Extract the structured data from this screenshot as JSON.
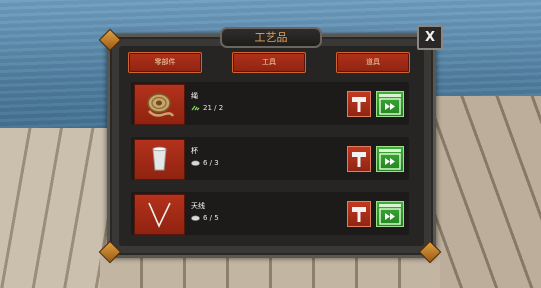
{
  "window": {
    "title": "工艺品",
    "close_label": "X"
  },
  "tabs": [
    {
      "label": "零部件"
    },
    {
      "label": "工具"
    },
    {
      "label": "道具"
    }
  ],
  "items": [
    {
      "name": "绳",
      "count": "21 / 2",
      "resource_icon": "grass-icon",
      "thumb_icon": "rope-icon"
    },
    {
      "name": "杯",
      "count": "6 / 3",
      "resource_icon": "plastic-icon",
      "thumb_icon": "cup-icon"
    },
    {
      "name": "天线",
      "count": "6 / 5",
      "resource_icon": "plastic-icon",
      "thumb_icon": "antenna-icon"
    }
  ],
  "colors": {
    "accent_red": "#b0321a",
    "accent_green": "#3fae3a",
    "title_orange": "#e4a35a",
    "panel_bg": "#262523"
  }
}
